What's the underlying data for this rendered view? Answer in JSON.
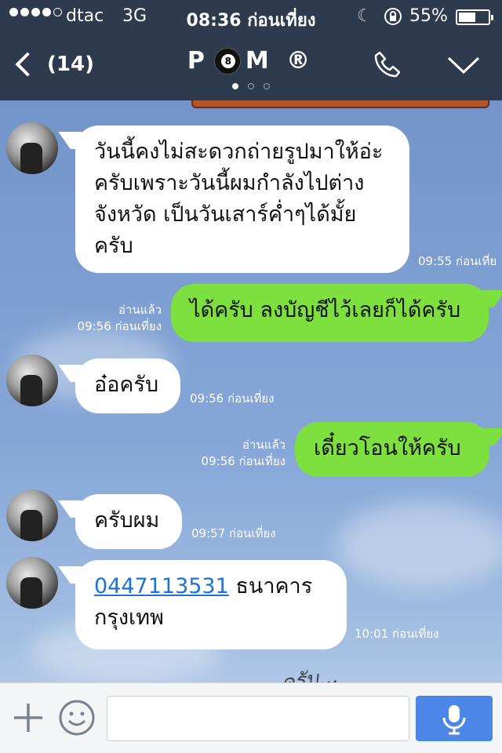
{
  "status_bar": {
    "carrier": "dtac",
    "network": "3G",
    "time": "08:36 ก่อนเที่ยง",
    "battery": "55%",
    "battery_level": 0.55,
    "signal_strength": 4
  },
  "header": {
    "back_count": "(14)",
    "title_left": "P",
    "title_right": "M ®",
    "page_indicator": {
      "total": 3,
      "active": 1
    }
  },
  "messages": [
    {
      "side": "in",
      "text": "วันนี้คงไม่สะดวกถ่ายรูปมาให้อ่ะครับเพราะวันนี้ผมกำลังไปต่างจังหวัด เป็นวันเสาร์ค่ำๆได้มั้ยครับ",
      "time": "09:55 ก่อนเที่ย"
    },
    {
      "side": "out",
      "text": "ได้ครับ ลงบัญชีไว้เลยก็ได้ครับ",
      "read": "อ่านแล้ว",
      "time": "09:56 ก่อนเที่ยง"
    },
    {
      "side": "in",
      "text": "อ๋อครับ",
      "time": "09:56 ก่อนเที่ยง"
    },
    {
      "side": "out",
      "text": "เดี๋ยวโอนให้ครับ",
      "read": "อ่านแล้ว",
      "time": "09:56 ก่อนเที่ยง"
    },
    {
      "side": "in",
      "text": "ครับผม",
      "time": "09:57 ก่อนเที่ยง"
    },
    {
      "side": "in",
      "link": "0447113531",
      "text": " ธนาคารกรุงเทพ",
      "time": "10:01 ก่อนเที่ยง"
    }
  ],
  "background_scribble": "ครับ...",
  "input": {
    "placeholder": "",
    "value": ""
  },
  "colors": {
    "header_bg": "#2e3a4e",
    "outgoing_bubble": "#7ee03f",
    "incoming_bubble": "#ffffff",
    "mic_button": "#4c86e6",
    "link": "#1a73d9"
  }
}
